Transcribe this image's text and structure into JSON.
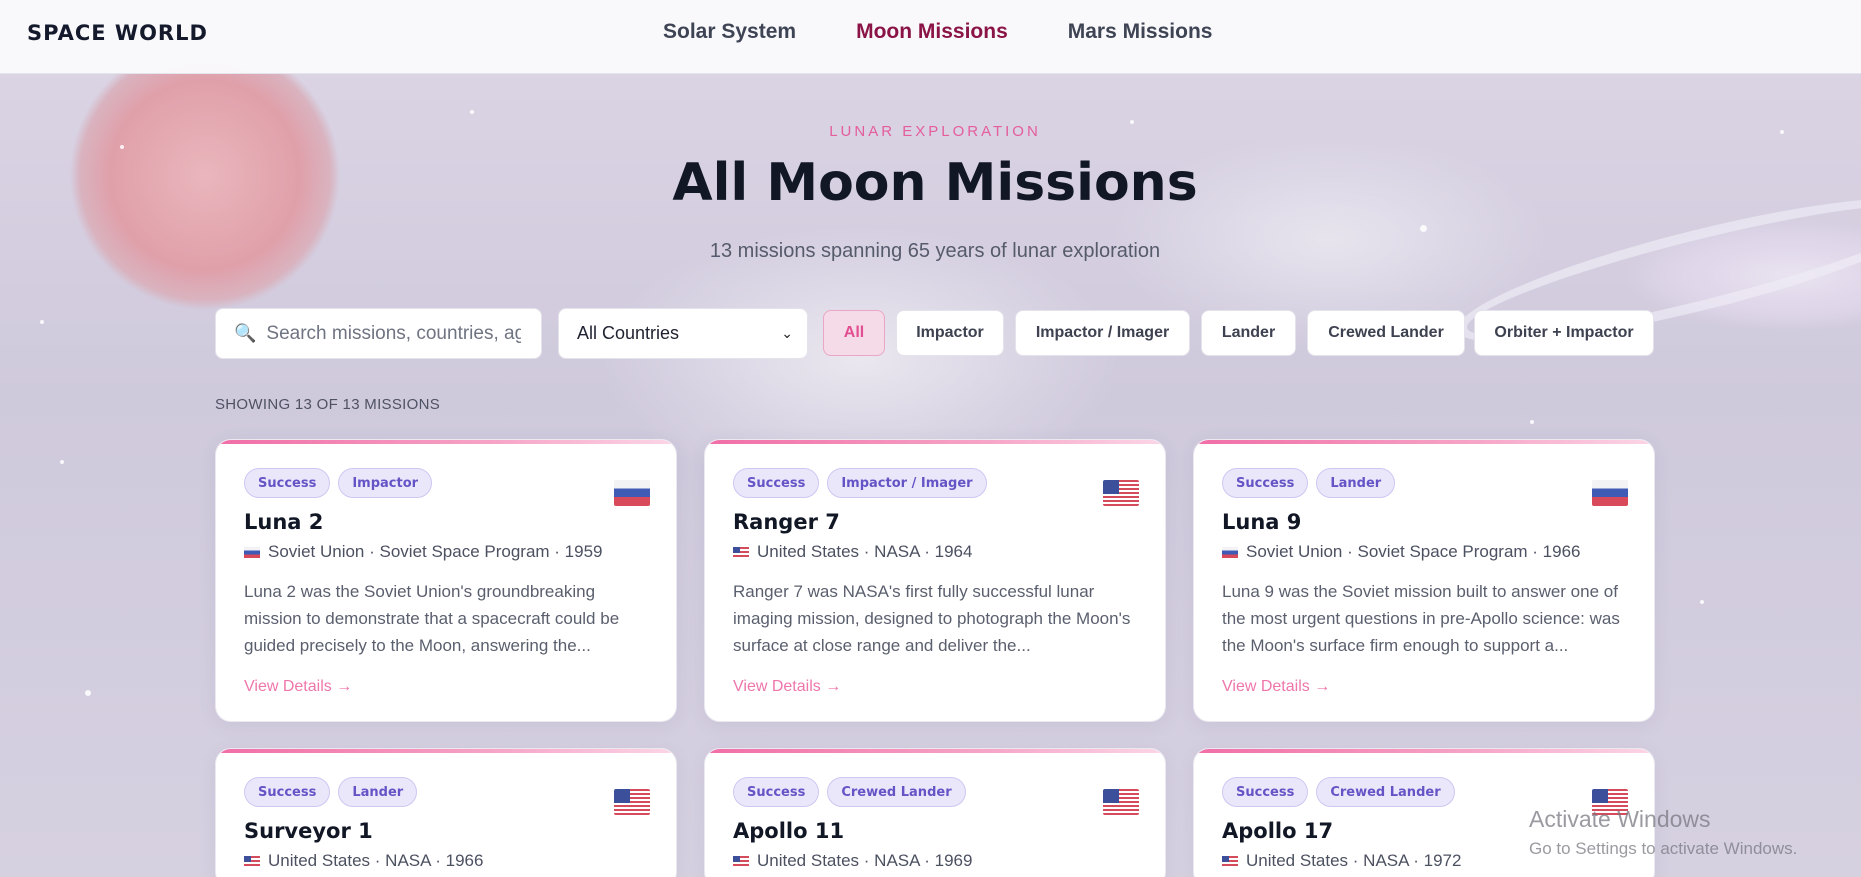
{
  "header": {
    "brand": "SPACE WORLD",
    "nav": [
      {
        "label": "Solar System",
        "active": false
      },
      {
        "label": "Moon Missions",
        "active": true
      },
      {
        "label": "Mars Missions",
        "active": false
      }
    ]
  },
  "hero": {
    "eyebrow": "LUNAR EXPLORATION",
    "title": "All Moon Missions",
    "subtitle": "13 missions spanning 65 years of lunar exploration"
  },
  "filters": {
    "search_placeholder": "Search missions, countries, agencies",
    "search_icon": "magnifier-icon",
    "country_select": "All Countries",
    "chips": [
      "All",
      "Impactor",
      "Impactor / Imager",
      "Lander",
      "Crewed Lander",
      "Orbiter + Impactor"
    ],
    "active_chip": "All"
  },
  "results": {
    "count_text": "SHOWING 13 OF 13 MISSIONS"
  },
  "missions": [
    {
      "status": "Success",
      "type": "Impactor",
      "flag": "ru",
      "name": "Luna 2",
      "meta": "Soviet Union · Soviet Space Program · 1959",
      "description": "Luna 2 was the Soviet Union's groundbreaking mission to demonstrate that a spacecraft could be guided precisely to the Moon, answering the...",
      "link": "View Details →"
    },
    {
      "status": "Success",
      "type": "Impactor / Imager",
      "flag": "us",
      "name": "Ranger 7",
      "meta": "United States · NASA · 1964",
      "description": "Ranger 7 was NASA's first fully successful lunar imaging mission, designed to photograph the Moon's surface at close range and deliver the...",
      "link": "View Details →"
    },
    {
      "status": "Success",
      "type": "Lander",
      "flag": "ru",
      "name": "Luna 9",
      "meta": "Soviet Union · Soviet Space Program · 1966",
      "description": "Luna 9 was the Soviet mission built to answer one of the most urgent questions in pre-Apollo science: was the Moon's surface firm enough to support a...",
      "link": "View Details →"
    },
    {
      "status": "Success",
      "type": "Lander",
      "flag": "us",
      "name": "Surveyor 1",
      "meta": "United States · NASA · 1966",
      "description": "",
      "link": ""
    },
    {
      "status": "Success",
      "type": "Crewed Lander",
      "flag": "us",
      "name": "Apollo 11",
      "meta": "United States · NASA · 1969",
      "description": "",
      "link": ""
    },
    {
      "status": "Success",
      "type": "Crewed Lander",
      "flag": "us",
      "name": "Apollo 17",
      "meta": "United States · NASA · 1972",
      "description": "",
      "link": ""
    }
  ],
  "watermark": {
    "line1": "Activate Windows",
    "line2": "Go to Settings to activate Windows."
  },
  "colors": {
    "accent_pink": "#e24e92",
    "nav_active": "#8b1446",
    "badge_purple": "#6554c6"
  }
}
